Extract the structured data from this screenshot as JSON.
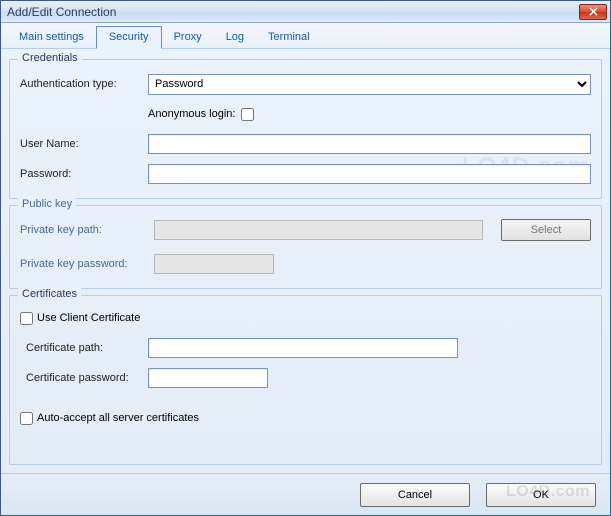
{
  "window": {
    "title": "Add/Edit Connection"
  },
  "tabs": {
    "main": "Main settings",
    "security": "Security",
    "proxy": "Proxy",
    "log": "Log",
    "terminal": "Terminal"
  },
  "credentials": {
    "legend": "Credentials",
    "authTypeLabel": "Authentication type:",
    "authTypeValue": "Password",
    "anonLabel": "Anonymous login:",
    "userLabel": "User Name:",
    "userValue": "",
    "passLabel": "Password:",
    "passValue": ""
  },
  "publicKey": {
    "legend": "Public key",
    "pathLabel": "Private key path:",
    "pathValue": "",
    "selectLabel": "Select",
    "passLabel": "Private key password:",
    "passValue": ""
  },
  "certificates": {
    "legend": "Certificates",
    "useClientLabel": "Use Client Certificate",
    "certPathLabel": "Certificate path:",
    "certPathValue": "",
    "certPassLabel": "Certificate password:",
    "certPassValue": "",
    "autoAcceptLabel": "Auto-accept all server certificates"
  },
  "footer": {
    "cancel": "Cancel",
    "ok": "OK"
  },
  "watermark": "LO4D.com"
}
